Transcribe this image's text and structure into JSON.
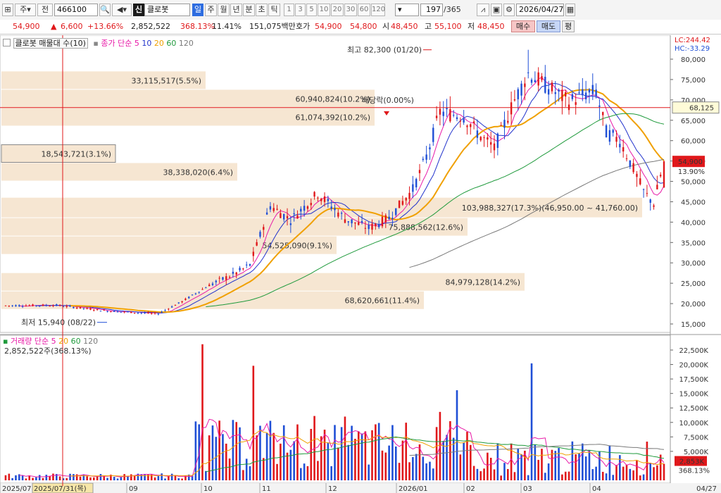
{
  "toolbar": {
    "period_label": "주",
    "market_label": "전",
    "code": "466100",
    "credit_badge": "신",
    "name": "클로봇",
    "daily_tab": "일",
    "tabs": [
      "주",
      "월",
      "년",
      "분",
      "초",
      "틱"
    ],
    "minute_steps": [
      "1",
      "3",
      "5",
      "10",
      "20",
      "30",
      "60",
      "120"
    ],
    "count_value": "197",
    "count_total": "/365",
    "date": "2026/04/27"
  },
  "quote": {
    "price": "54,900",
    "change": "6,600",
    "change_pct": "+13.66%",
    "volume": "2,852,522",
    "volume_ratio": "368.13%",
    "turnover": "11.41%",
    "amount": "151,075백만",
    "bid_label": "호가",
    "ask": "54,900",
    "bid": "54,800",
    "open_label": "시",
    "open": "48,450",
    "high_label": "고",
    "high": "55,100",
    "low_label": "저",
    "low": "48,450",
    "buy_button": "매수",
    "sell_button": "매도",
    "eval_button": "평"
  },
  "panel": {
    "title": "클로봇 매물대 수(10)",
    "ma_label": "종가 단순",
    "ma_periods": [
      "5",
      "10",
      "20",
      "60",
      "120"
    ],
    "lc": "LC:244.42",
    "hc": "HC:-33.29",
    "volume_label": "거래량 단순",
    "volume_ma_periods": [
      "5",
      "20",
      "60",
      "120"
    ],
    "volume_value": "2,852,522주(368.13%)",
    "dividend": "배당락(0.00%)",
    "high_mark": "최고 82,300 (01/20)",
    "low_mark": "최저 15,940 (08/22)",
    "crosshair_date": "2025/07/31(목)",
    "hline_price": "68,125",
    "price_tag": "54,900",
    "price_tag_pct": "13.90%",
    "vol_tag_value": "2,853K",
    "vol_tag_pct": "368.13%",
    "date_labels": [
      "2025/07",
      "09",
      "10",
      "11",
      "12",
      "2026/01",
      "02",
      "03",
      "04"
    ],
    "right_date": "04/27"
  },
  "chart_data": {
    "type": "candlestick",
    "price_axis": [
      "80,000",
      "75,000",
      "70,000",
      "65,000",
      "60,000",
      "55,000",
      "50,000",
      "45,000",
      "40,000",
      "35,000",
      "30,000",
      "25,000",
      "20,000",
      "15,000"
    ],
    "volume_axis": [
      "22,500K",
      "20,000K",
      "17,500K",
      "15,000K",
      "12,500K",
      "10,000K",
      "7,500K",
      "5,000K"
    ],
    "volume_profile": [
      {
        "label": "33,115,517(5.5%)",
        "low": 72500,
        "high": 77000
      },
      {
        "label": "60,940,824(10.2%)",
        "low": 68000,
        "high": 72500
      },
      {
        "label": "61,074,392(10.2%)",
        "low": 63500,
        "high": 68000
      },
      {
        "label": "18,543,721(3.1%)",
        "low": 54500,
        "high": 59000
      },
      {
        "label": "38,338,020(6.4%)",
        "low": 50000,
        "high": 54500
      },
      {
        "label": "103,988,327(17.3%)(46,950.00 ~ 41,760.00)",
        "low": 41000,
        "high": 46000
      },
      {
        "label": "75,888,562(12.6%)",
        "low": 36500,
        "high": 41000
      },
      {
        "label": "54,525,090(9.1%)",
        "low": 32000,
        "high": 36500
      },
      {
        "label": "84,979,128(14.2%)",
        "low": 23000,
        "high": 27500
      },
      {
        "label": "68,620,661(11.4%)",
        "low": 18500,
        "high": 23000
      }
    ]
  },
  "colors": {
    "up": "#e0181b",
    "down": "#1f4fd6",
    "ma5": "#e81aa8",
    "ma10": "#2233cc",
    "ma20": "#f0a000",
    "ma60": "#1f9a3c",
    "ma120": "#7a7a7a",
    "profile": "#f6e6d2"
  }
}
